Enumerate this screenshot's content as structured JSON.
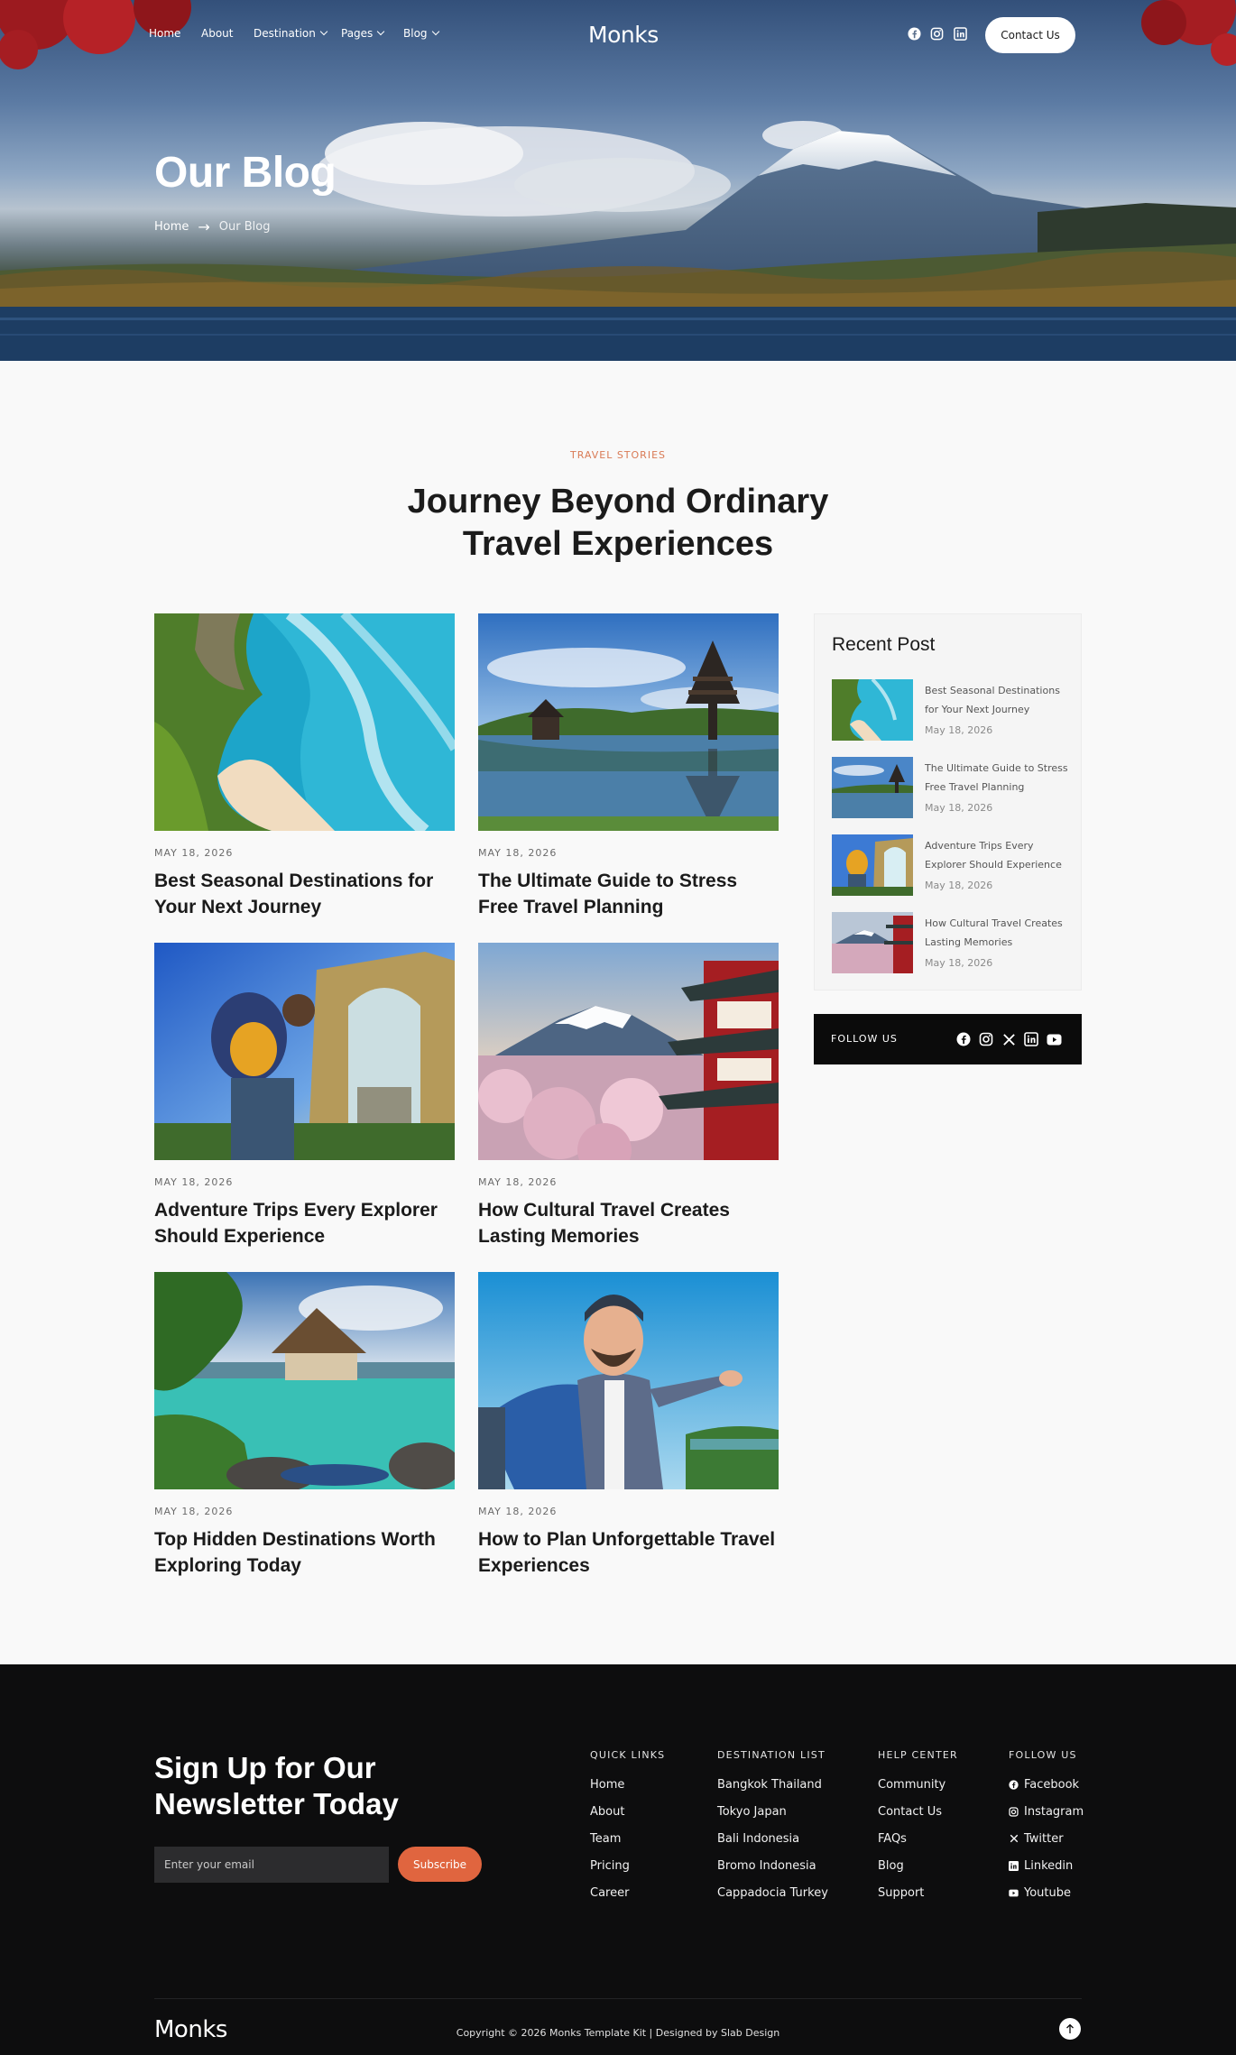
{
  "nav": {
    "items": [
      {
        "label": "Home",
        "dropdown": false
      },
      {
        "label": "About",
        "dropdown": false
      },
      {
        "label": "Destination",
        "dropdown": true
      },
      {
        "label": "Pages",
        "dropdown": true
      },
      {
        "label": "Blog",
        "dropdown": true
      }
    ],
    "logo": "Monks",
    "social_icons": [
      "facebook-icon",
      "instagram-icon",
      "linkedin-icon"
    ],
    "contact_label": "Contact Us"
  },
  "hero": {
    "title": "Our Blog",
    "breadcrumb": {
      "home": "Home",
      "separator": "→",
      "current": "Our Blog"
    }
  },
  "section": {
    "eyebrow": "TRAVEL STORIES",
    "title_line1": "Journey Beyond Ordinary",
    "title_line2": "Travel Experiences"
  },
  "posts": [
    {
      "date": "MAY 18, 2026",
      "title": "Best Seasonal Destinations for Your Next Journey",
      "image": "tropical-cliff-beach"
    },
    {
      "date": "MAY 18, 2026",
      "title": "The Ultimate Guide to Stress Free Travel Planning",
      "image": "lake-temple-pagoda"
    },
    {
      "date": "MAY 18, 2026",
      "title": "Adventure Trips Every Explorer Should Experience",
      "image": "backpacker-ancient-gate"
    },
    {
      "date": "MAY 18, 2026",
      "title": "How Cultural Travel Creates Lasting Memories",
      "image": "mount-fuji-pagoda-blossoms"
    },
    {
      "date": "MAY 18, 2026",
      "title": "Top Hidden Destinations Worth Exploring Today",
      "image": "tropical-lagoon-villa"
    },
    {
      "date": "MAY 18, 2026",
      "title": "How to Plan Unforgettable Travel Experiences",
      "image": "smiling-traveler-selfie"
    }
  ],
  "sidebar": {
    "recent_title": "Recent Post",
    "recent": [
      {
        "title": "Best Seasonal Destinations for Your Next Journey",
        "date": "May 18, 2026"
      },
      {
        "title": "The Ultimate Guide to Stress Free Travel Planning",
        "date": "May 18, 2026"
      },
      {
        "title": "Adventure Trips Every Explorer Should Experience",
        "date": "May 18, 2026"
      },
      {
        "title": "How Cultural Travel Creates Lasting Memories",
        "date": "May 18, 2026"
      }
    ],
    "follow_label": "FOLLOW US",
    "follow_icons": [
      "facebook-icon",
      "instagram-icon",
      "x-twitter-icon",
      "linkedin-icon",
      "youtube-icon"
    ]
  },
  "footer": {
    "newsletter_title_line1": "Sign Up for Our",
    "newsletter_title_line2": "Newsletter Today",
    "email_placeholder": "Enter your email",
    "subscribe_label": "Subscribe",
    "columns": [
      {
        "heading": "QUICK LINKS",
        "links": [
          "Home",
          "About",
          "Team",
          "Pricing",
          "Career"
        ]
      },
      {
        "heading": "DESTINATION LIST",
        "links": [
          "Bangkok Thailand",
          "Tokyo Japan",
          "Bali Indonesia",
          "Bromo Indonesia",
          "Cappadocia Turkey"
        ]
      },
      {
        "heading": "HELP CENTER",
        "links": [
          "Community",
          "Contact Us",
          "FAQs",
          "Blog",
          "Support"
        ]
      },
      {
        "heading": "FOLLOW US",
        "links": [
          "Facebook",
          "Instagram",
          "Twitter",
          "Linkedin",
          "Youtube"
        ]
      }
    ],
    "logo": "Monks",
    "copyright": "Copyright © 2026 Monks Template Kit | Designed by Slab Design"
  },
  "colors": {
    "accent": "#e0653f",
    "eyebrow": "#d97a55",
    "footer_bg": "#0d0d0e",
    "page_bg": "#f9f9f9"
  }
}
